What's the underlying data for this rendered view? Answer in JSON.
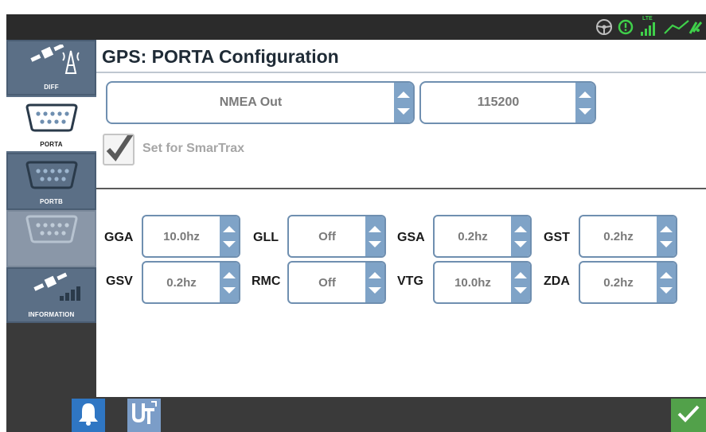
{
  "page_title": "GPS: PORTA Configuration",
  "nav": {
    "items": [
      {
        "label": "DIFF",
        "icon": "satellite-tower-icon"
      },
      {
        "label": "PORTA",
        "icon": "serial-port-icon"
      },
      {
        "label": "PORTB",
        "icon": "serial-port-icon"
      },
      {
        "label": "",
        "icon": "serial-port-icon"
      },
      {
        "label": "INFORMATION",
        "icon": "satellite-signal-icon"
      }
    ]
  },
  "port": {
    "mode_value": "NMEA Out",
    "baud_value": "115200"
  },
  "smartrax": {
    "label": "Set for SmarTrax",
    "checked": true
  },
  "messages": [
    {
      "name": "GGA",
      "value": "10.0hz"
    },
    {
      "name": "GLL",
      "value": "Off"
    },
    {
      "name": "GSA",
      "value": "0.2hz"
    },
    {
      "name": "GST",
      "value": "0.2hz"
    },
    {
      "name": "GSV",
      "value": "0.2hz"
    },
    {
      "name": "RMC",
      "value": "Off"
    },
    {
      "name": "VTG",
      "value": "10.0hz"
    },
    {
      "name": "ZDA",
      "value": "0.2hz"
    }
  ],
  "status_bar": {
    "lte_label": "LTE",
    "icons": [
      "steering-wheel-icon",
      "alert-circle-icon",
      "lte-signal-icon",
      "gps-signal-icon"
    ]
  },
  "colors": {
    "accent_blue": "#7fa3c7",
    "nav_blue": "#5b6f86",
    "confirm_green": "#52a14a",
    "alarm_blue": "#2f76c3",
    "status_green": "#3fcf4a"
  }
}
